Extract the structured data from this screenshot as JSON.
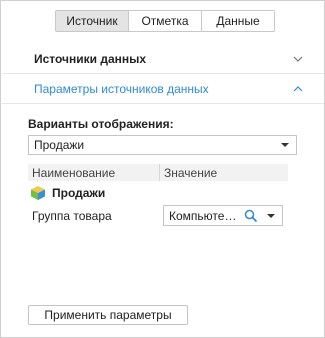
{
  "tabs": [
    {
      "label": "Источник",
      "active": true
    },
    {
      "label": "Отметка",
      "active": false
    },
    {
      "label": "Данные",
      "active": false
    }
  ],
  "sections": {
    "data_sources": {
      "label": "Источники данных",
      "icon": "chevron-down-icon"
    },
    "source_params": {
      "label": "Параметры источников данных",
      "icon": "chevron-up-icon"
    }
  },
  "display_variants": {
    "label": "Варианты отображения:",
    "selected": "Продажи"
  },
  "grid": {
    "columns": [
      "Наименование",
      "Значение"
    ],
    "group": {
      "label": "Продажи",
      "icon": "cube-icon"
    },
    "params": [
      {
        "name": "Группа товара",
        "value": "Компьютерная техника"
      }
    ]
  },
  "apply_button": "Применить параметры",
  "colors": {
    "accent": "#2f8ad6",
    "tab_active_bg": "#e4e4e4",
    "border": "#c4c4c4"
  }
}
